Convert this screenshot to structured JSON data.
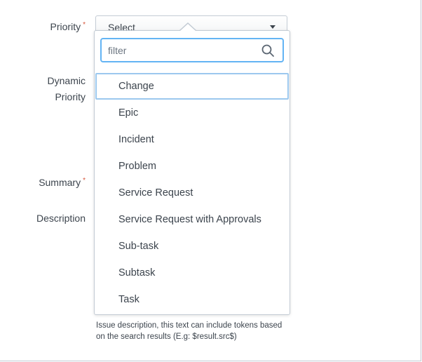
{
  "form": {
    "priority_label": "Priority",
    "dynamic_priority_label_line1": "Dynamic",
    "dynamic_priority_label_line2": "Priority",
    "summary_label": "Summary",
    "description_label": "Description",
    "required_marker": "*",
    "description_help": "Issue description, this text can include tokens based on the search results (E.g: $result.src$)"
  },
  "priority_select": {
    "selected_value": "Select",
    "filter_placeholder": "filter",
    "options": [
      "Change",
      "Epic",
      "Incident",
      "Problem",
      "Service Request",
      "Service Request with Approvals",
      "Sub-task",
      "Subtask",
      "Task"
    ],
    "highlighted_option": "Change"
  },
  "icons": {
    "filter_search": "search-icon",
    "select_caret": "caret-down-icon"
  },
  "colors": {
    "focus_border": "#63b4f4",
    "highlight_border": "#9cc8ee",
    "required_marker": "#d6563c",
    "text": "#3c444d"
  }
}
